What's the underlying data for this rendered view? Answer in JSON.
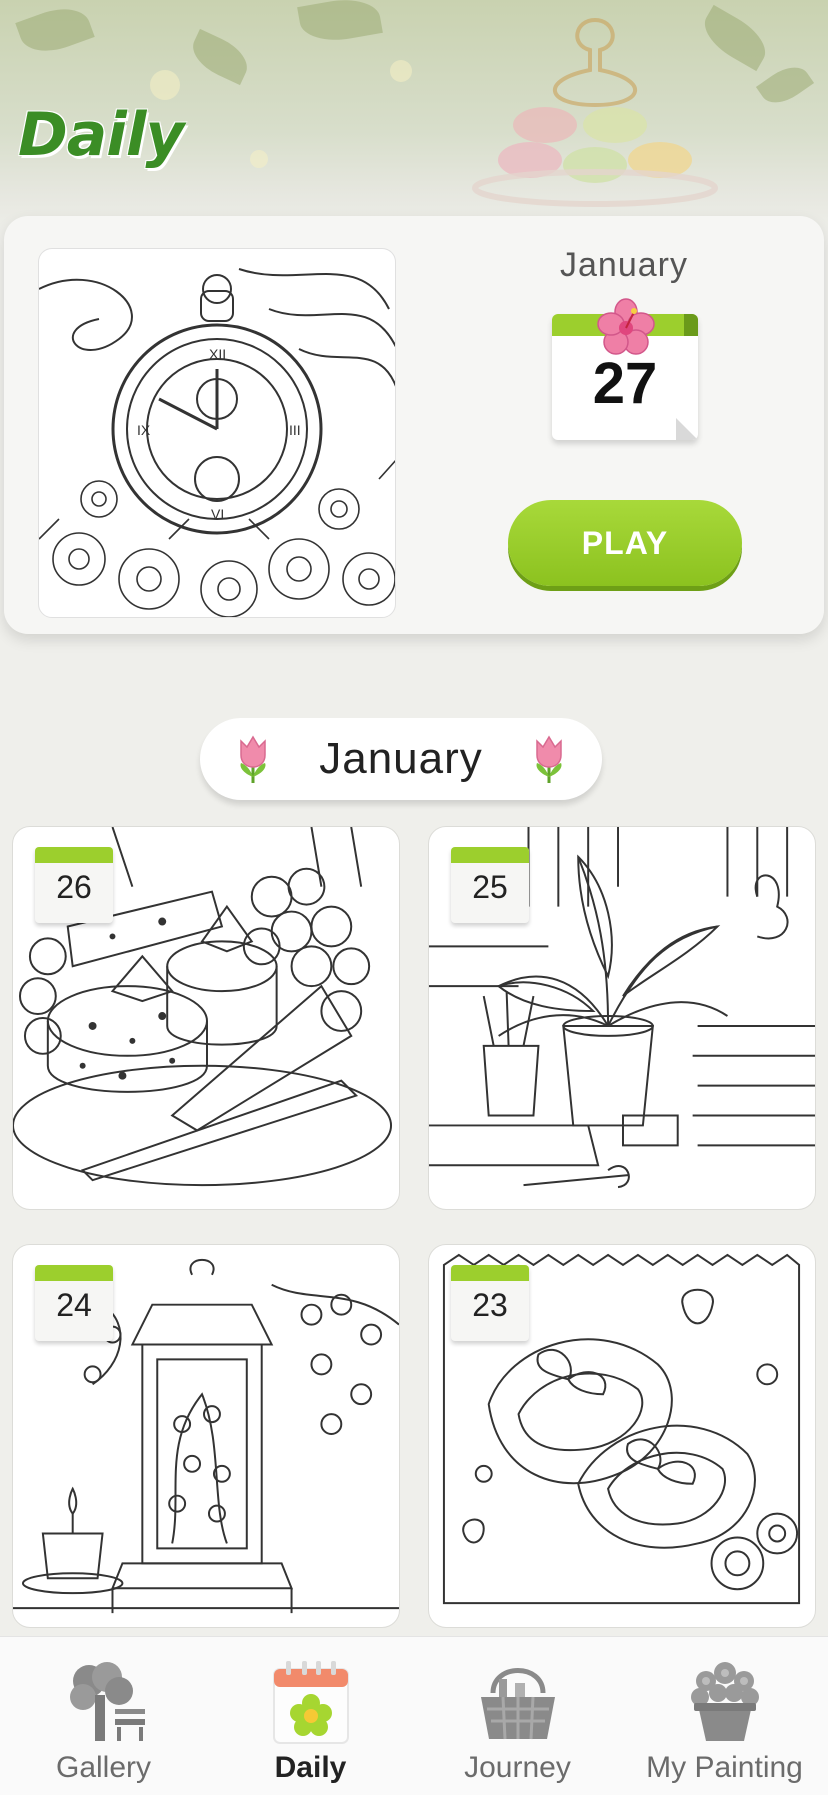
{
  "header": {
    "title": "Daily"
  },
  "featured": {
    "month": "January",
    "day": "27",
    "play_label": "PLAY",
    "artwork": "pocket-watch-with-flowers"
  },
  "month_section": {
    "label": "January",
    "decor_icon": "tulip-icon"
  },
  "daily_cards": [
    {
      "day": "26",
      "artwork": "cheese-and-grapes"
    },
    {
      "day": "25",
      "artwork": "potted-plant-desk"
    },
    {
      "day": "24",
      "artwork": "lantern-with-blossoms"
    },
    {
      "day": "23",
      "artwork": "mary-jane-shoes"
    }
  ],
  "bottom_nav": {
    "items": [
      {
        "label": "Gallery",
        "icon": "tree-bench-icon",
        "active": false
      },
      {
        "label": "Daily",
        "icon": "calendar-flower-icon",
        "active": true
      },
      {
        "label": "Journey",
        "icon": "picnic-basket-icon",
        "active": false
      },
      {
        "label": "My Painting",
        "icon": "flower-pot-icon",
        "active": false
      }
    ]
  },
  "colors": {
    "accent_green": "#9ccf2d",
    "title_green": "#3b8d25",
    "background": "#efefeb"
  }
}
